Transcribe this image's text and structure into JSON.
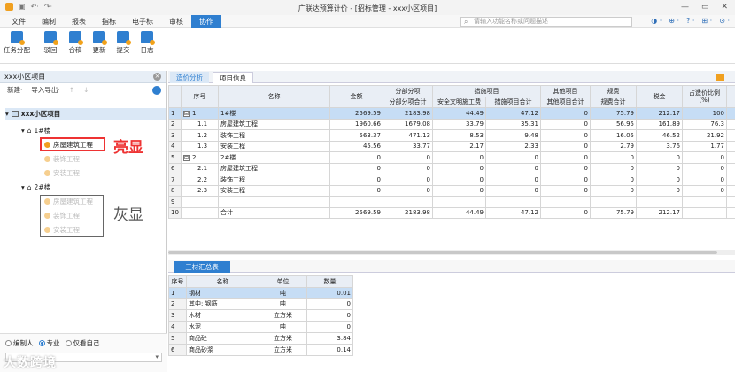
{
  "window": {
    "title": "广联达预算计价 - [招标管理 - xxx小区项目]",
    "controls": [
      "—",
      "▭",
      "✕"
    ]
  },
  "menu": {
    "items": [
      "文件",
      "编制",
      "报表",
      "指标",
      "电子标",
      "审核",
      "协作"
    ],
    "active": "协作",
    "search_placeholder": "请输入功能名称或问题描述",
    "right_icons": [
      "◑ ·",
      "⊕ ·",
      "? ·",
      "⊞ ·",
      "⊙ ·"
    ]
  },
  "toolbar": {
    "buttons": [
      "任务分配",
      "驳回",
      "合稿",
      "更新",
      "提交",
      "日志"
    ]
  },
  "left_panel": {
    "title": "xxx小区项目",
    "actions": {
      "new": "新建·",
      "import_export": "导入导出·",
      "up": "↑",
      "down": "↓"
    },
    "tree": {
      "root": "xxx小区项目",
      "building1": "1#楼",
      "building1_children": [
        "房屋建筑工程",
        "装饰工程",
        "安装工程"
      ],
      "building2": "2#楼",
      "building2_children": [
        "房屋建筑工程",
        "装饰工程",
        "安装工程"
      ]
    },
    "annotations": {
      "bright": "亮显",
      "gray": "灰显"
    },
    "radios": [
      "编制人",
      "专业",
      "仅看自己"
    ],
    "radio_selected": "专业",
    "select_arrow": "▾",
    "watermark": "大数跨境"
  },
  "tabs": [
    "造价分析",
    "项目信息"
  ],
  "cost_table": {
    "headers": {
      "seq": "序号",
      "name": "名称",
      "amount": "金额",
      "subitem_group": "分部分项",
      "subitem_total": "分部分项合计",
      "measures_group": "措施项目",
      "safety_fee": "安全文明施工费",
      "measures_total": "措施项目合计",
      "other_group": "其他项目",
      "other_total": "其他项目合计",
      "fees_group": "规费",
      "fees_total": "规费合计",
      "tax": "税金",
      "ratio": "占造价比例(%)",
      "extra": "工"
    },
    "rows": [
      {
        "rn": "1",
        "tree": "⊟",
        "seq": "1",
        "name": "1#楼",
        "amount": "2569.59",
        "subitem": "2183.98",
        "safety": "44.49",
        "measures": "47.12",
        "other": "0",
        "fees": "75.79",
        "tax": "212.17",
        "ratio": "100"
      },
      {
        "rn": "2",
        "tree": "",
        "seq": "1.1",
        "name": "房屋建筑工程",
        "amount": "1960.66",
        "subitem": "1679.08",
        "safety": "33.79",
        "measures": "35.31",
        "other": "0",
        "fees": "56.95",
        "tax": "161.89",
        "ratio": "76.3"
      },
      {
        "rn": "3",
        "tree": "",
        "seq": "1.2",
        "name": "装饰工程",
        "amount": "563.37",
        "subitem": "471.13",
        "safety": "8.53",
        "measures": "9.48",
        "other": "0",
        "fees": "16.05",
        "tax": "46.52",
        "ratio": "21.92"
      },
      {
        "rn": "4",
        "tree": "",
        "seq": "1.3",
        "name": "安装工程",
        "amount": "45.56",
        "subitem": "33.77",
        "safety": "2.17",
        "measures": "2.33",
        "other": "0",
        "fees": "2.79",
        "tax": "3.76",
        "ratio": "1.77"
      },
      {
        "rn": "5",
        "tree": "⊟",
        "seq": "2",
        "name": "2#楼",
        "amount": "0",
        "subitem": "0",
        "safety": "0",
        "measures": "0",
        "other": "0",
        "fees": "0",
        "tax": "0",
        "ratio": "0"
      },
      {
        "rn": "6",
        "tree": "",
        "seq": "2.1",
        "name": "房屋建筑工程",
        "amount": "0",
        "subitem": "0",
        "safety": "0",
        "measures": "0",
        "other": "0",
        "fees": "0",
        "tax": "0",
        "ratio": "0"
      },
      {
        "rn": "7",
        "tree": "",
        "seq": "2.2",
        "name": "装饰工程",
        "amount": "0",
        "subitem": "0",
        "safety": "0",
        "measures": "0",
        "other": "0",
        "fees": "0",
        "tax": "0",
        "ratio": "0"
      },
      {
        "rn": "8",
        "tree": "",
        "seq": "2.3",
        "name": "安装工程",
        "amount": "0",
        "subitem": "0",
        "safety": "0",
        "measures": "0",
        "other": "0",
        "fees": "0",
        "tax": "0",
        "ratio": "0"
      },
      {
        "rn": "9",
        "tree": "",
        "seq": "",
        "name": "",
        "amount": "",
        "subitem": "",
        "safety": "",
        "measures": "",
        "other": "",
        "fees": "",
        "tax": "",
        "ratio": ""
      },
      {
        "rn": "10",
        "tree": "",
        "seq": "",
        "name": "合计",
        "amount": "2569.59",
        "subitem": "2183.98",
        "safety": "44.49",
        "measures": "47.12",
        "other": "0",
        "fees": "75.79",
        "tax": "212.17",
        "ratio": ""
      }
    ]
  },
  "materials_tab": "三材汇总表",
  "materials_table": {
    "headers": [
      "序号",
      "名称",
      "单位",
      "数量"
    ],
    "rows": [
      [
        "1",
        "钢材",
        "吨",
        "0.01"
      ],
      [
        "2",
        "其中: 钢筋",
        "吨",
        "0"
      ],
      [
        "3",
        "木材",
        "立方米",
        "0"
      ],
      [
        "4",
        "水泥",
        "吨",
        "0"
      ],
      [
        "5",
        "商品砼",
        "立方米",
        "3.84"
      ],
      [
        "6",
        "商品砂浆",
        "立方米",
        "0.14"
      ]
    ]
  },
  "colors": {
    "accent": "#2f7fd0",
    "highlight": "#e33333",
    "selection": "#c6ddf5"
  }
}
